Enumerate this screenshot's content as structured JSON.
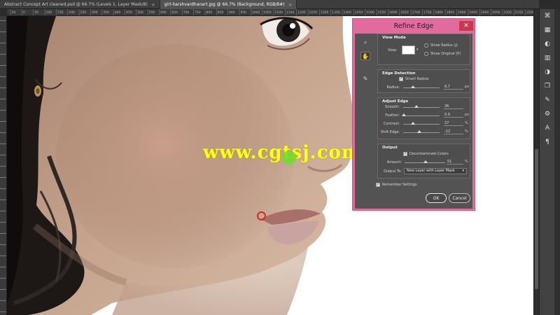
{
  "tabs": [
    {
      "label": "Abstract Concept Art cleaned.psd @ 66.7% (Levels 1, Layer Mask/8)",
      "active": false
    },
    {
      "label": "girl-harshvardhanart.jpg @ 66.7% (Background, RGB/8#)",
      "active": true
    }
  ],
  "ruler_labels": [
    "50",
    "0",
    "50",
    "100",
    "150",
    "200",
    "250",
    "300",
    "350",
    "400",
    "450",
    "500",
    "550",
    "600",
    "650",
    "700",
    "750",
    "800",
    "850",
    "900",
    "950",
    "1000",
    "1050",
    "1100",
    "1150",
    "1200",
    "1250",
    "1300",
    "1350",
    "1400",
    "1450",
    "1500",
    "1550",
    "1600",
    "1650",
    "1700",
    "1750",
    "1800",
    "1850",
    "1900",
    "1950",
    "2000",
    "2050",
    "2100",
    "2150",
    "2200"
  ],
  "watermark": "www.cgtsj.com",
  "dialog": {
    "title": "Refine Edge",
    "close_glyph": "✕",
    "view_mode": {
      "heading": "View Mode",
      "view_label": "View:",
      "show_radius": "Show Radius (J)",
      "show_original": "Show Original (P)"
    },
    "edge_detection": {
      "heading": "Edge Detection",
      "smart_radius": "Smart Radius",
      "smart_radius_checked": true,
      "radius_label": "Radius:",
      "radius_value": "6.7",
      "radius_unit": "px",
      "radius_fraction": 0.27
    },
    "adjust_edge": {
      "heading": "Adjust Edge",
      "rows": [
        {
          "label": "Smooth:",
          "value": "36",
          "unit": "",
          "fraction": 0.36
        },
        {
          "label": "Feather:",
          "value": "0.9",
          "unit": "px",
          "fraction": 0.02
        },
        {
          "label": "Contrast:",
          "value": "27",
          "unit": "%",
          "fraction": 0.27
        },
        {
          "label": "Shift Edge:",
          "value": "-12",
          "unit": "%",
          "fraction": 0.44
        }
      ]
    },
    "output": {
      "heading": "Output",
      "decontaminate": "Decontaminate Colors",
      "decontaminate_checked": true,
      "amount_label": "Amount:",
      "amount_value": "51",
      "amount_unit": "%",
      "amount_fraction": 0.51,
      "output_to_label": "Output To:",
      "output_to_value": "New Layer with Layer Mask"
    },
    "remember": "Remember Settings",
    "remember_checked": true,
    "ok": "OK",
    "cancel": "Cancel"
  },
  "colors": {
    "dialog_frame": "#e26a9c",
    "dialog_body": "#535353",
    "watermark": "#ffff1a",
    "brush_green": "#6edc28",
    "brush_red": "#d8262b"
  },
  "icons": [
    "zoom-icon",
    "hand-icon",
    "refine-brush-icon",
    "layers-icon",
    "paragraph-icon",
    "character-icon",
    "brush-icon",
    "info-icon",
    "adjustments-icon"
  ]
}
